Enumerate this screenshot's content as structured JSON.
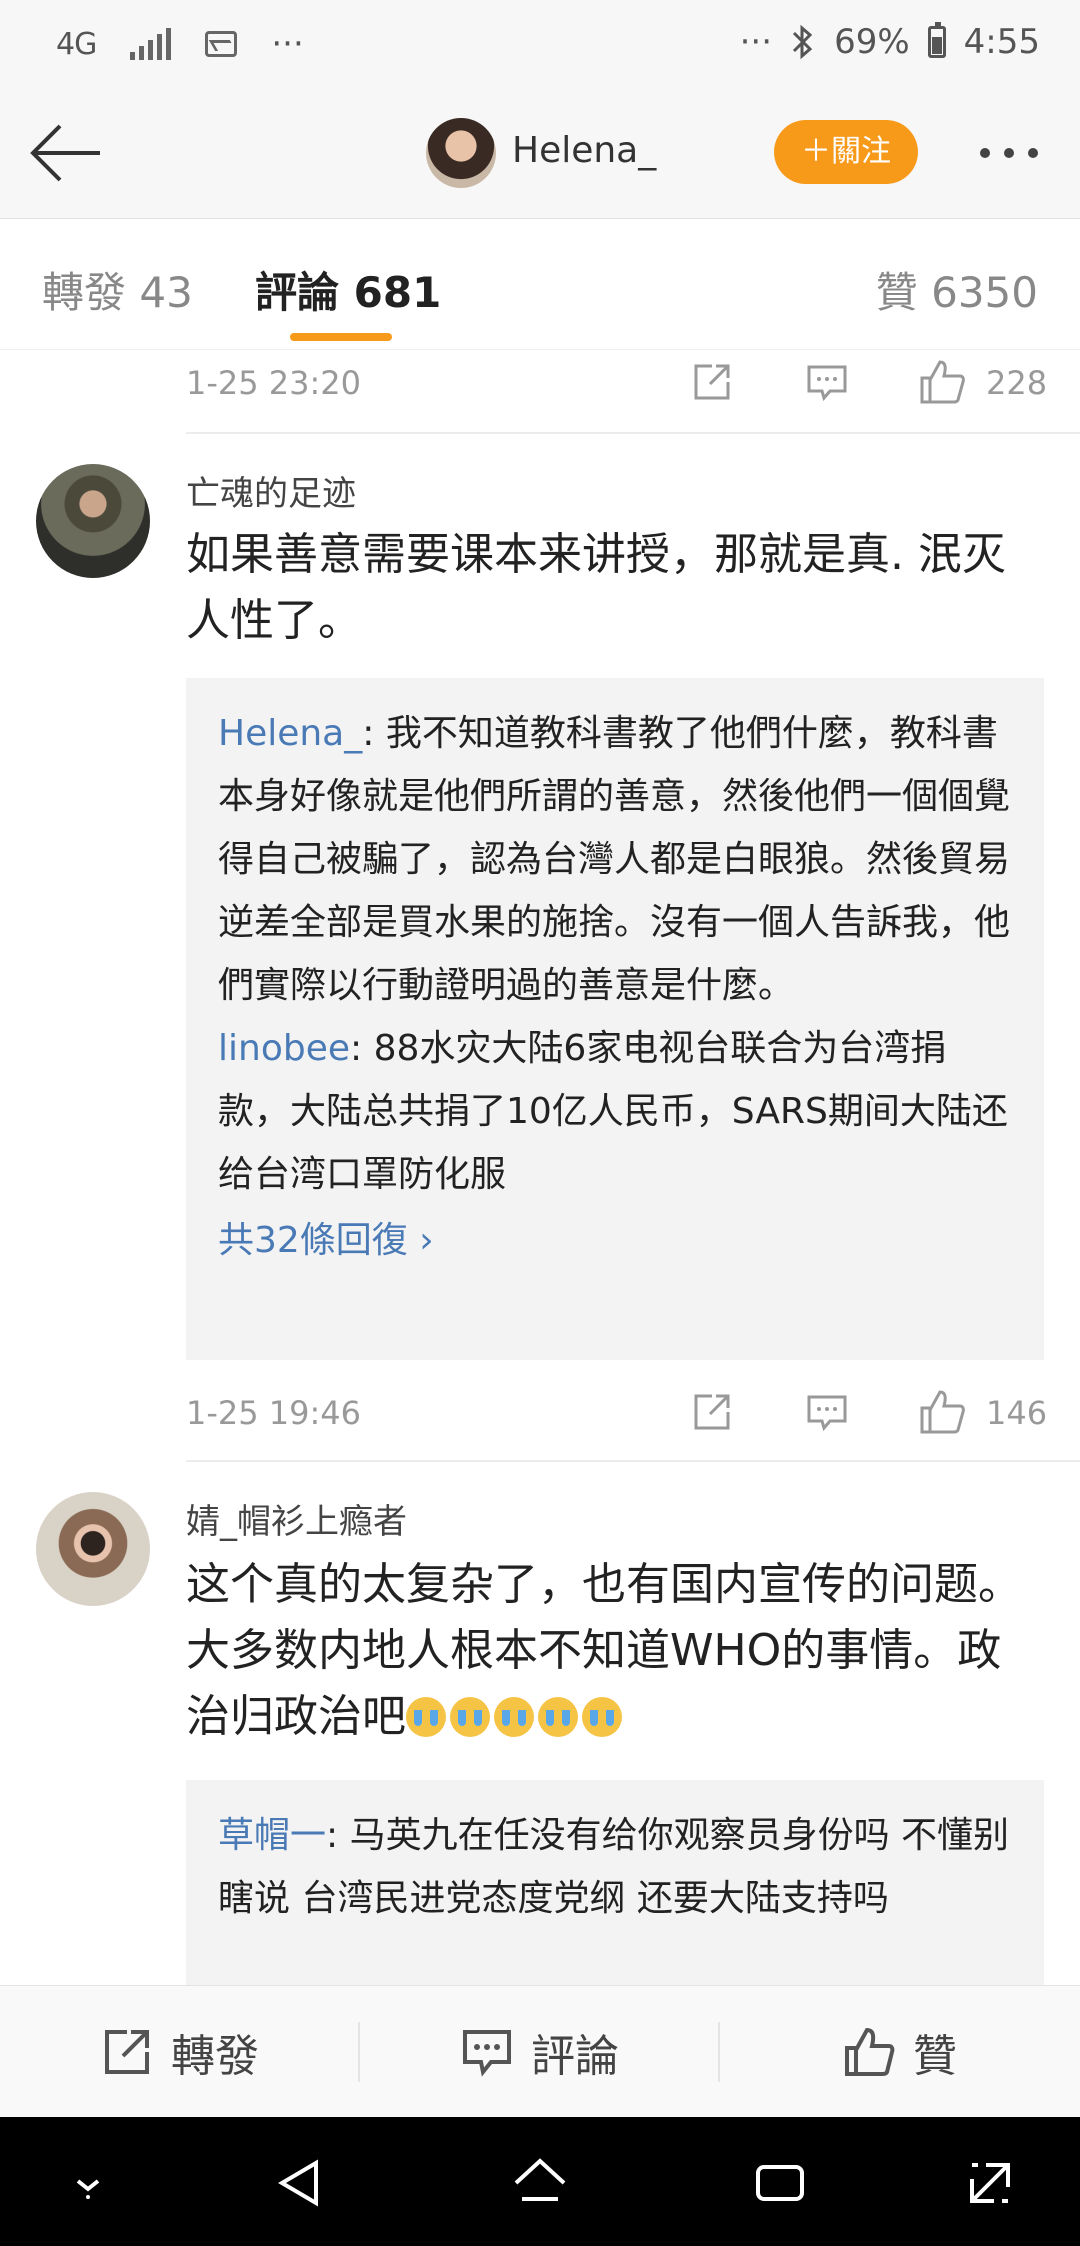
{
  "status_bar": {
    "network": "4G",
    "more_dots": "···",
    "bluetooth_dots": "···",
    "battery": "69%",
    "time": "4:55"
  },
  "header": {
    "user_name": "Helena_",
    "follow_label": "＋關注"
  },
  "tabs": {
    "repost": "轉發 43",
    "comments": "評論 681",
    "likes": "贊 6350"
  },
  "comments": [
    {
      "top_meta": {
        "time": "1-25 23:20",
        "likes": "228"
      },
      "user": "亡魂的足迹",
      "text": "如果善意需要课本来讲授，那就是真. 泯灭人性了。",
      "replies": [
        {
          "name": "Helena_",
          "text": ": 我不知道教科書教了他們什麼，教科書本身好像就是他們所謂的善意，然後他們一個個覺得自己被騙了，認為台灣人都是白眼狼。然後貿易逆差全部是買水果的施捨。沒有一個人告訴我，他們實際以行動證明過的善意是什麼。"
        },
        {
          "name": "linobee",
          "text": ": 88水灾大陆6家电视台联合为台湾捐款，大陆总共捐了10亿人民币，SARS期间大陆还给台湾口罩防化服"
        }
      ],
      "more_replies": "共32條回復 ›",
      "meta": {
        "time": "1-25 19:46",
        "likes": "146"
      }
    },
    {
      "user": "婧_帽衫上瘾者",
      "text": "这个真的太复杂了，也有国内宣传的问题。大多数内地人根本不知道WHO的事情。政治归政治吧",
      "emoji_name": "crying-emoji",
      "emoji_count": 5,
      "replies": [
        {
          "name": "草帽一",
          "text": ": 马英九在任没有给你观察员身份吗 不懂别瞎说 台湾民进党态度党纲 还要大陆支持吗"
        }
      ]
    }
  ],
  "action_bar": {
    "repost": "轉發",
    "comment": "評論",
    "like": "贊"
  },
  "colors": {
    "accent_orange": "#f79a1a",
    "link_blue": "#4a7ab6"
  }
}
